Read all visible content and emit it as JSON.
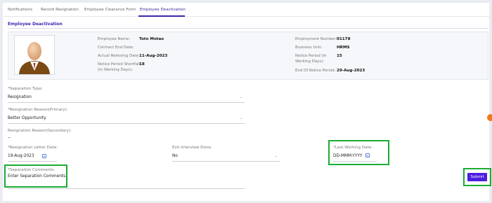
{
  "tabs": [
    {
      "label": "Notifications"
    },
    {
      "label": "Record Resignation"
    },
    {
      "label": "Employee Clearance Form"
    },
    {
      "label": "Employee Deactivation"
    }
  ],
  "section_title": "Employee Deactivation",
  "employee": {
    "name_label": "Employee Name:",
    "name": "Toto Motao",
    "contract_end_label": "Contract End Date:",
    "contract_end": "",
    "relieving_label": "Actual Relieving Date:",
    "relieving": "11-Aug-2023",
    "shortfall_label_1": "Notice Period Shortfall",
    "shortfall_label_2": "(In Working Days):",
    "shortfall": "18",
    "number_label": "Employment Number:",
    "number": "01178",
    "unit_label": "Business Unit:",
    "unit": "HRMS",
    "notice_label_1": "Notice Period (In",
    "notice_label_2": "Working Days):",
    "notice": "15",
    "end_notice_label": "End Of Notice Period:",
    "end_notice": "29-Aug-2023"
  },
  "form": {
    "separation_type": {
      "label": "*Separation Type:",
      "value": "Resignation"
    },
    "reason_primary": {
      "label": "*Resignation Reason(Primary):",
      "value": "Better Opportunity"
    },
    "reason_secondary": {
      "label": "Resignation Reason(Secondary):",
      "value": "--"
    },
    "letter_date": {
      "label": "*Resignation Letter Date:",
      "value": "19-Aug-2023"
    },
    "exit_interview": {
      "label": "Exit Interview Done:",
      "value": "No"
    },
    "last_working": {
      "label": "*Last Working Date:",
      "placeholder": "DD-MMM-YYYY"
    },
    "comments": {
      "label": "*Separation Comments:",
      "placeholder": "Enter Separation Comments."
    }
  },
  "submit_label": "Submit",
  "colors": {
    "accent": "#3a28b0",
    "button": "#4b1fe0",
    "highlight": "#1aad36"
  }
}
